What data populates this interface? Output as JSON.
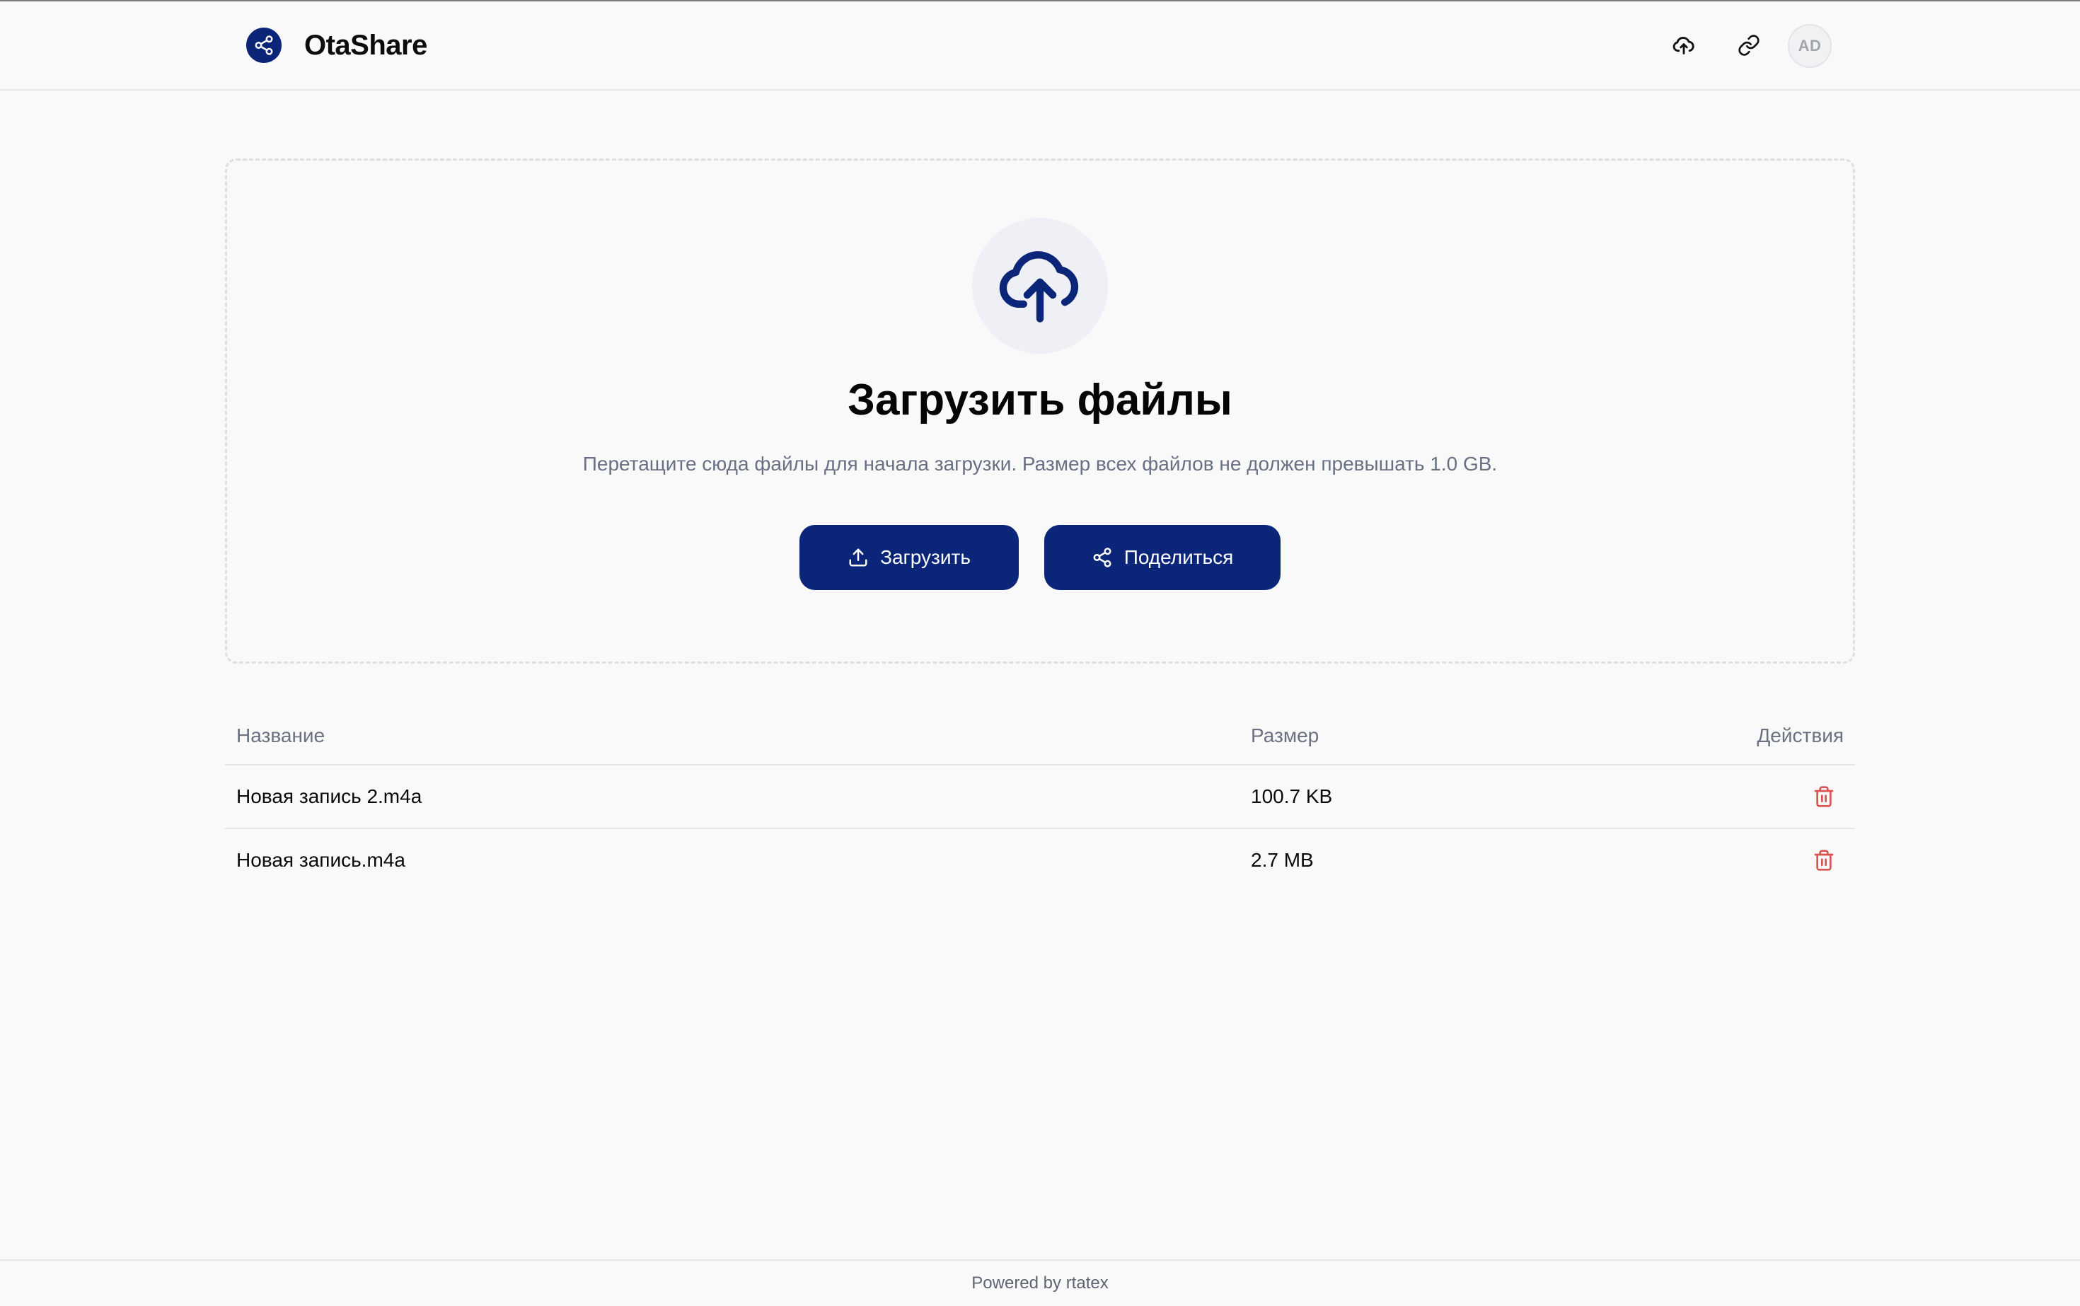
{
  "header": {
    "app_name": "OtaShare",
    "avatar_initials": "AD",
    "icons": [
      "share-icon",
      "cloud-upload-icon",
      "link-icon"
    ]
  },
  "dropzone": {
    "title": "Загрузить файлы",
    "description": "Перетащите сюда файлы для начала загрузки. Размер всех файлов не должен превышать 1.0 GB.",
    "upload_button": "Загрузить",
    "share_button": "Поделиться"
  },
  "table": {
    "headers": {
      "name": "Название",
      "size": "Размер",
      "actions": "Действия"
    },
    "rows": [
      {
        "name": "Новая запись 2.m4a",
        "size": "100.7 KB"
      },
      {
        "name": "Новая запись.m4a",
        "size": "2.7 MB"
      }
    ]
  },
  "footer": {
    "text": "Powered by rtatex"
  },
  "colors": {
    "primary": "#0b2578",
    "background": "#f9f9fa",
    "danger": "#d9534f",
    "muted_text": "#687083"
  }
}
